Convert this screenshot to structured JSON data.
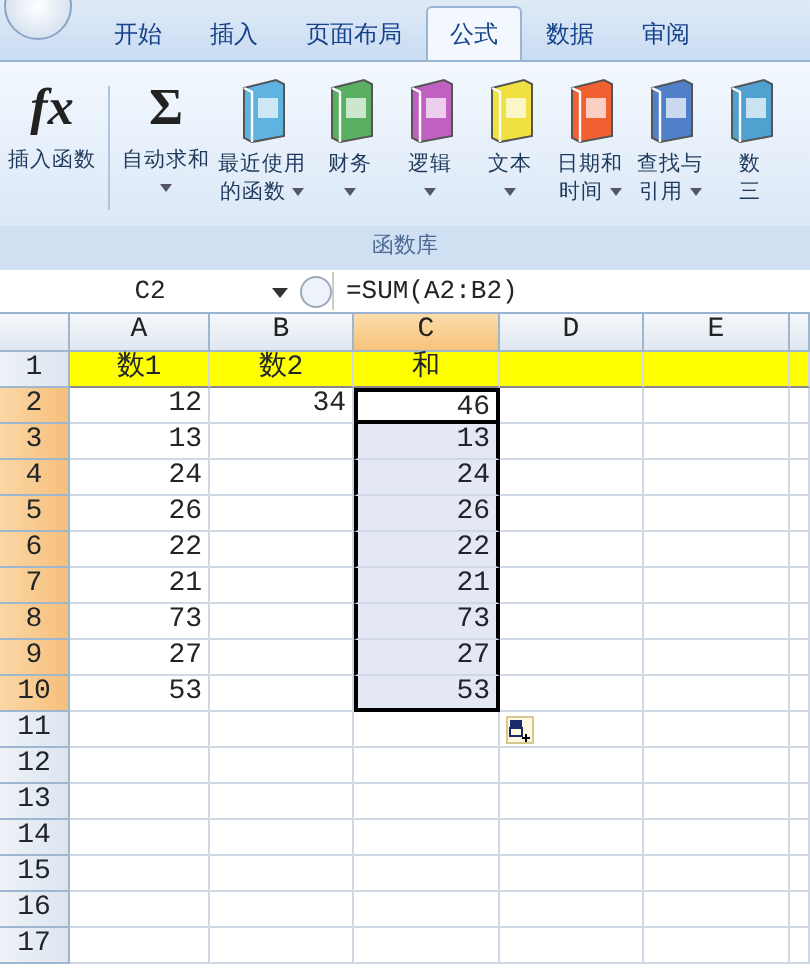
{
  "tabs": [
    {
      "label": "开始",
      "selected": false
    },
    {
      "label": "插入",
      "selected": false
    },
    {
      "label": "页面布局",
      "selected": false
    },
    {
      "label": "公式",
      "selected": true
    },
    {
      "label": "数据",
      "selected": false
    },
    {
      "label": "审阅",
      "selected": false
    }
  ],
  "ribbon": {
    "group_label": "函数库",
    "buttons": [
      {
        "kind": "fx",
        "glyph": "fx",
        "lines": [
          "插入函数"
        ],
        "dropdown": false
      },
      {
        "kind": "sigma",
        "glyph": "Σ",
        "lines": [
          "自动求和"
        ],
        "dropdown": true
      },
      {
        "kind": "book",
        "color": "#5fb3e0",
        "lines": [
          "最近使用",
          "的函数"
        ],
        "dropdown": true
      },
      {
        "kind": "book",
        "color": "#58b060",
        "lines": [
          "财务"
        ],
        "dropdown": true
      },
      {
        "kind": "book",
        "color": "#c060c0",
        "lines": [
          "逻辑"
        ],
        "dropdown": true
      },
      {
        "kind": "book",
        "color": "#f0e040",
        "lines": [
          "文本"
        ],
        "dropdown": true
      },
      {
        "kind": "book",
        "color": "#f06030",
        "lines": [
          "日期和",
          "时间"
        ],
        "dropdown": true
      },
      {
        "kind": "book",
        "color": "#5080c8",
        "lines": [
          "查找与",
          "引用"
        ],
        "dropdown": true
      },
      {
        "kind": "book",
        "color": "#50a0d0",
        "lines": [
          "数",
          "三"
        ],
        "dropdown": false
      }
    ]
  },
  "formula_bar": {
    "name_box": "C2",
    "formula": "=SUM(A2:B2)"
  },
  "sheet": {
    "columns": [
      {
        "label": "A",
        "selected": false
      },
      {
        "label": "B",
        "selected": false
      },
      {
        "label": "C",
        "selected": true
      },
      {
        "label": "D",
        "selected": false
      },
      {
        "label": "E",
        "selected": false
      }
    ],
    "rows": [
      {
        "label": "1",
        "kind": "header",
        "selected": false,
        "active": false,
        "cells": [
          "数1",
          "数2",
          "和",
          "",
          ""
        ]
      },
      {
        "label": "2",
        "kind": "data",
        "selected": true,
        "active": true,
        "cells": [
          "12",
          "34",
          "46",
          "",
          ""
        ]
      },
      {
        "label": "3",
        "kind": "data",
        "selected": true,
        "active": false,
        "cells": [
          "13",
          "",
          "13",
          "",
          ""
        ]
      },
      {
        "label": "4",
        "kind": "data",
        "selected": true,
        "active": false,
        "cells": [
          "24",
          "",
          "24",
          "",
          ""
        ]
      },
      {
        "label": "5",
        "kind": "data",
        "selected": true,
        "active": false,
        "cells": [
          "26",
          "",
          "26",
          "",
          ""
        ]
      },
      {
        "label": "6",
        "kind": "data",
        "selected": true,
        "active": false,
        "cells": [
          "22",
          "",
          "22",
          "",
          ""
        ]
      },
      {
        "label": "7",
        "kind": "data",
        "selected": true,
        "active": false,
        "cells": [
          "21",
          "",
          "21",
          "",
          ""
        ]
      },
      {
        "label": "8",
        "kind": "data",
        "selected": true,
        "active": false,
        "cells": [
          "73",
          "",
          "73",
          "",
          ""
        ]
      },
      {
        "label": "9",
        "kind": "data",
        "selected": true,
        "active": false,
        "cells": [
          "27",
          "",
          "27",
          "",
          ""
        ]
      },
      {
        "label": "10",
        "kind": "data",
        "selected": true,
        "active": false,
        "cells": [
          "53",
          "",
          "53",
          "",
          ""
        ]
      },
      {
        "label": "11",
        "kind": "data",
        "selected": false,
        "active": false,
        "cells": [
          "",
          "",
          "",
          "",
          ""
        ]
      },
      {
        "label": "12",
        "kind": "data",
        "selected": false,
        "active": false,
        "cells": [
          "",
          "",
          "",
          "",
          ""
        ]
      },
      {
        "label": "13",
        "kind": "data",
        "selected": false,
        "active": false,
        "cells": [
          "",
          "",
          "",
          "",
          ""
        ]
      },
      {
        "label": "14",
        "kind": "data",
        "selected": false,
        "active": false,
        "cells": [
          "",
          "",
          "",
          "",
          ""
        ]
      },
      {
        "label": "15",
        "kind": "data",
        "selected": false,
        "active": false,
        "cells": [
          "",
          "",
          "",
          "",
          ""
        ]
      },
      {
        "label": "16",
        "kind": "data",
        "selected": false,
        "active": false,
        "cells": [
          "",
          "",
          "",
          "",
          ""
        ]
      },
      {
        "label": "17",
        "kind": "data",
        "selected": false,
        "active": false,
        "cells": [
          "",
          "",
          "",
          "",
          ""
        ]
      }
    ]
  }
}
